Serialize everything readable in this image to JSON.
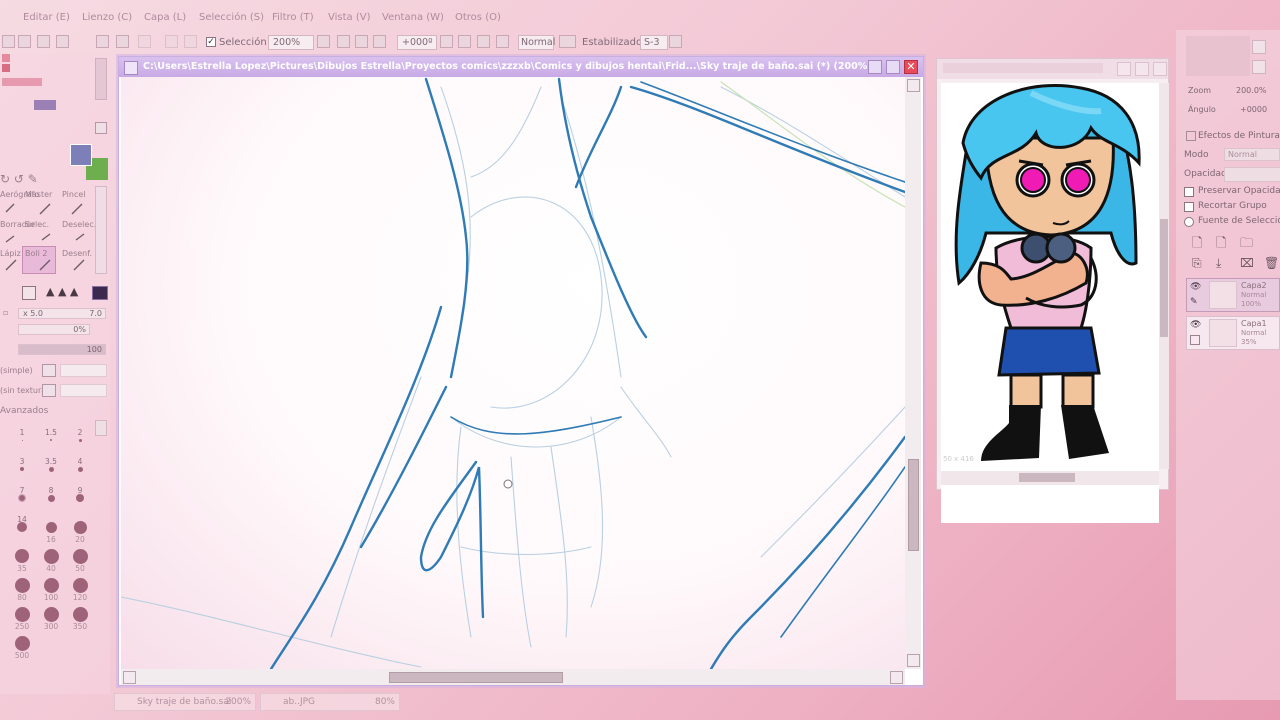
{
  "menu": [
    "Editar (E)",
    "Lienzo (C)",
    "Capa (L)",
    "Selección (S)",
    "Filtro (T)",
    "Vista (V)",
    "Ventana (W)",
    "Otros (O)"
  ],
  "toolbar": {
    "selection_label": "Selección",
    "zoom_value": "200%",
    "angle_value": "+000º",
    "blend_mode": "Normal",
    "stabilizer_label": "Estabilizador",
    "stabilizer_value": "S-3"
  },
  "left_panel": {
    "tools": [
      "Aerógrafo",
      "Master",
      "Pincel",
      "Borrador",
      "Selec.",
      "Deselec.",
      "Lápiz",
      "Boli 2",
      "Desenf."
    ],
    "size_multiplier": "x 5.0",
    "size_value": "7.0",
    "min_size": "0%",
    "density": "100",
    "texture_label": "(simple)",
    "texture2_label": "(sin textura)",
    "advanced_label": "Avanzados",
    "brush_sizes": [
      "1",
      "1.5",
      "2",
      "3",
      "3.5",
      "4",
      "7",
      "8",
      "9",
      "14",
      "16",
      "20",
      "35",
      "40",
      "50",
      "80",
      "100",
      "120",
      "250",
      "300",
      "350",
      "500"
    ],
    "colors": {
      "primary": "#7c7fb8",
      "secondary": "#6fae4f"
    }
  },
  "canvas": {
    "title": "C:\\Users\\Estrella Lopez\\Pictures\\Dibujos Estrella\\Proyectos comics\\zzzxb\\Comics y dibujos hentai\\Frid...\\Sky traje de baño.sai (*) (200%)"
  },
  "navigator": {
    "size_label": "50 x 416"
  },
  "right_panel": {
    "zoom_label": "Zoom",
    "zoom_value": "200.0%",
    "angle_label": "Ángulo",
    "angle_value": "+0000",
    "paint_effects_label": "Efectos de Pintura",
    "mode_label": "Modo",
    "mode_value": "Normal",
    "opacity_label": "Opacidad",
    "preserve_opacity": "Preservar Opacidad",
    "clip_group": "Recortar Grupo",
    "selection_source": "Fuente de Selección",
    "layers": [
      {
        "name": "Capa2",
        "mode": "Normal",
        "opacity": "100%"
      },
      {
        "name": "Capa1",
        "mode": "Normal",
        "opacity": "35%"
      }
    ]
  },
  "status": {
    "tabs": [
      {
        "name": "Sky traje de baño.sai",
        "zoom": "200%"
      },
      {
        "name": "ab..JPG",
        "zoom": "80%"
      }
    ]
  }
}
